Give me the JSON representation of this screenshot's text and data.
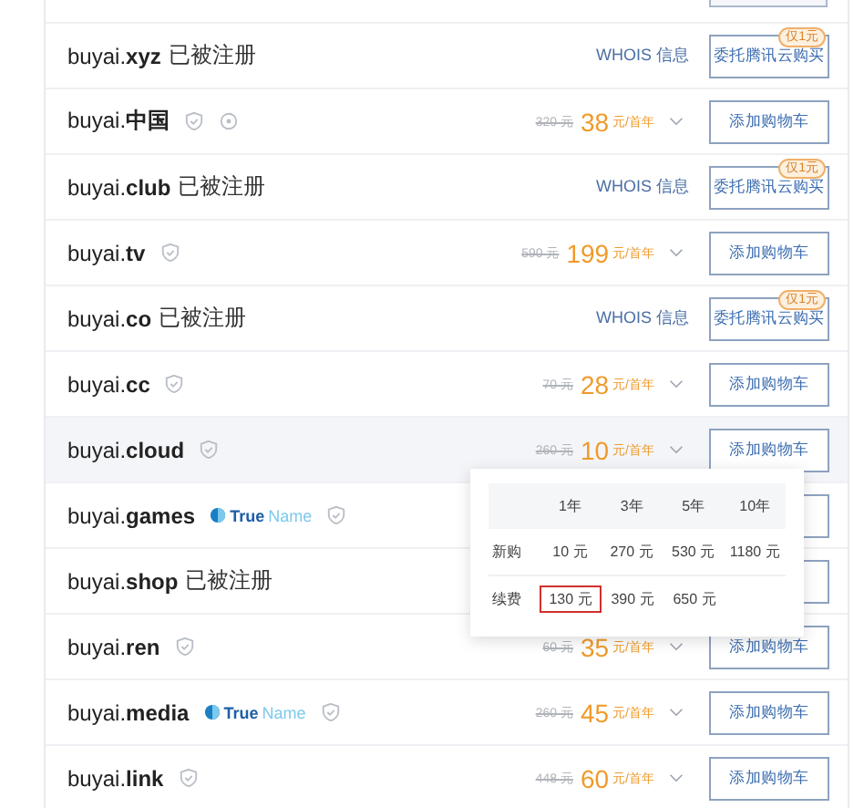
{
  "rows": [
    {
      "prefix": "buyai.",
      "tld": "xyz",
      "kind": "registered",
      "status": "已被注册",
      "whois": "WHOIS 信息",
      "button": "委托腾讯云购买",
      "badge": "仅1元"
    },
    {
      "prefix": "buyai.",
      "tld": "中国",
      "kind": "available",
      "shield": true,
      "info": true,
      "old_price": "320 元",
      "price": "38",
      "unit": "元/首年",
      "button": "添加购物车",
      "highlighted": false
    },
    {
      "prefix": "buyai.",
      "tld": "club",
      "kind": "registered",
      "status": "已被注册",
      "whois": "WHOIS 信息",
      "button": "委托腾讯云购买",
      "badge": "仅1元"
    },
    {
      "prefix": "buyai.",
      "tld": "tv",
      "kind": "available",
      "shield": true,
      "old_price": "590 元",
      "price": "199",
      "unit": "元/首年",
      "button": "添加购物车",
      "highlighted": false
    },
    {
      "prefix": "buyai.",
      "tld": "co",
      "kind": "registered",
      "status": "已被注册",
      "whois": "WHOIS 信息",
      "button": "委托腾讯云购买",
      "badge": "仅1元"
    },
    {
      "prefix": "buyai.",
      "tld": "cc",
      "kind": "available",
      "shield": true,
      "old_price": "70 元",
      "price": "28",
      "unit": "元/首年",
      "button": "添加购物车",
      "highlighted": false
    },
    {
      "prefix": "buyai.",
      "tld": "cloud",
      "kind": "available",
      "shield": true,
      "old_price": "260 元",
      "price": "10",
      "unit": "元/首年",
      "button": "添加购物车",
      "highlighted": true
    },
    {
      "prefix": "buyai.",
      "tld": "games",
      "kind": "covered",
      "truename": "True",
      "truename_2": "Name",
      "shield": true
    },
    {
      "prefix": "buyai.",
      "tld": "shop",
      "kind": "covered",
      "status": "已被注册"
    },
    {
      "prefix": "buyai.",
      "tld": "ren",
      "kind": "available",
      "shield": true,
      "old_price": "60 元",
      "price": "35",
      "unit": "元/首年",
      "button": "添加购物车",
      "highlighted": false
    },
    {
      "prefix": "buyai.",
      "tld": "media",
      "kind": "available",
      "truename": "True",
      "truename_2": "Name",
      "shield": true,
      "old_price": "260 元",
      "price": "45",
      "unit": "元/首年",
      "button": "添加购物车",
      "highlighted": false
    },
    {
      "prefix": "buyai.",
      "tld": "link",
      "kind": "available",
      "shield": true,
      "old_price": "448 元",
      "price": "60",
      "unit": "元/首年",
      "button": "添加购物车",
      "highlighted": false
    }
  ],
  "price_popup": {
    "columns": [
      "1年",
      "3年",
      "5年",
      "10年"
    ],
    "rows": [
      {
        "label": "新购",
        "cells": [
          {
            "text": "10 元",
            "selected": false
          },
          {
            "text": "270 元",
            "selected": false
          },
          {
            "text": "530 元",
            "selected": false
          },
          {
            "text": "1180 元",
            "selected": false
          }
        ]
      },
      {
        "label": "续费",
        "cells": [
          {
            "text": "130 元",
            "selected": true
          },
          {
            "text": "390 元",
            "selected": false
          },
          {
            "text": "650 元",
            "selected": false
          }
        ]
      }
    ]
  }
}
